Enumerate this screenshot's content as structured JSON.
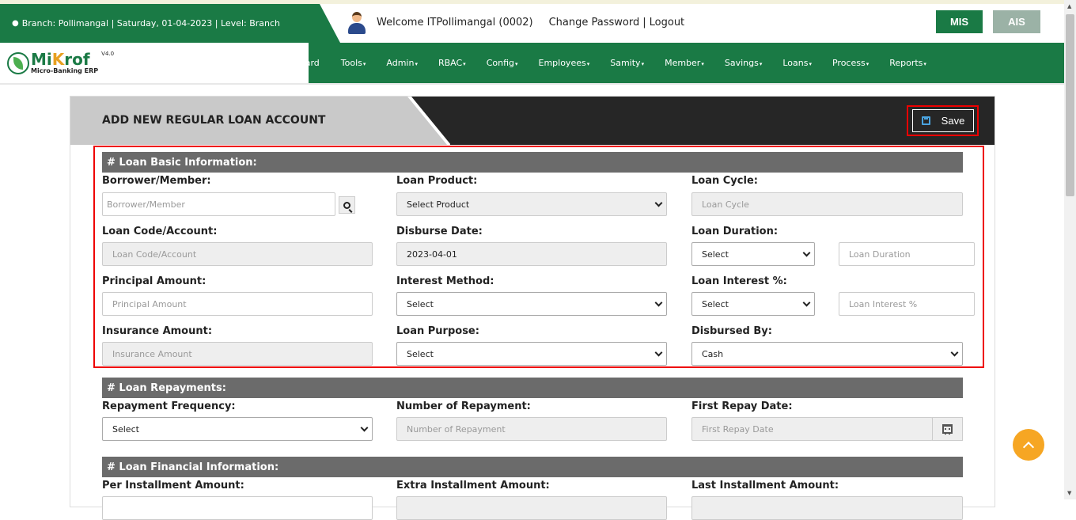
{
  "header": {
    "branch_info": "Branch: Pollimangal | Saturday, 01-04-2023 | Level: Branch",
    "welcome": "Welcome ITPollimangal (0002)",
    "change_password": "Change Password",
    "separator": "|",
    "logout": "Logout",
    "mis_label": "MIS",
    "ais_label": "AIS"
  },
  "logo": {
    "name_a": "Mi",
    "name_b": "K",
    "name_c": "rof",
    "subtitle": "Micro-Banking ERP",
    "version": "V4.0"
  },
  "nav": {
    "items": [
      {
        "label": "board",
        "caret": ""
      },
      {
        "label": "Tools",
        "caret": "▾"
      },
      {
        "label": "Admin",
        "caret": "▾"
      },
      {
        "label": "RBAC",
        "caret": "▾"
      },
      {
        "label": "Config",
        "caret": "▾"
      },
      {
        "label": "Employees",
        "caret": "▾"
      },
      {
        "label": "Samity",
        "caret": "▾"
      },
      {
        "label": "Member",
        "caret": "▾"
      },
      {
        "label": "Savings",
        "caret": "▾"
      },
      {
        "label": "Loans",
        "caret": "▾"
      },
      {
        "label": "Process",
        "caret": "▾"
      },
      {
        "label": "Reports",
        "caret": "▾"
      }
    ]
  },
  "page": {
    "title": "ADD NEW REGULAR LOAN ACCOUNT",
    "save_label": "Save"
  },
  "basic": {
    "section_title": "# Loan Basic Information:",
    "borrower_label": "Borrower/Member:",
    "borrower_placeholder": "Borrower/Member",
    "product_label": "Loan Product:",
    "product_value": "Select Product",
    "cycle_label": "Loan Cycle:",
    "cycle_placeholder": "Loan Cycle",
    "code_label": "Loan Code/Account:",
    "code_placeholder": "Loan Code/Account",
    "disburse_date_label": "Disburse Date:",
    "disburse_date_value": "2023-04-01",
    "duration_label": "Loan Duration:",
    "duration_select": "Select",
    "duration_placeholder": "Loan Duration",
    "principal_label": "Principal Amount:",
    "principal_placeholder": "Principal Amount",
    "interest_method_label": "Interest Method:",
    "interest_method_value": "Select",
    "interest_pct_label": "Loan Interest %:",
    "interest_pct_select": "Select",
    "interest_pct_placeholder": "Loan Interest %",
    "insurance_label": "Insurance Amount:",
    "insurance_placeholder": "Insurance Amount",
    "purpose_label": "Loan Purpose:",
    "purpose_value": "Select",
    "disbursed_by_label": "Disbursed By:",
    "disbursed_by_value": "Cash"
  },
  "repayments": {
    "section_title": "# Loan Repayments:",
    "frequency_label": "Repayment Frequency:",
    "frequency_value": "Select",
    "number_label": "Number of Repayment:",
    "number_placeholder": "Number of Repayment",
    "first_date_label": "First Repay Date:",
    "first_date_placeholder": "First Repay Date"
  },
  "financial": {
    "section_title": "# Loan Financial Information:",
    "per_installment_label": "Per Installment Amount:",
    "extra_installment_label": "Extra Installment Amount:",
    "last_installment_label": "Last Installment Amount:"
  }
}
